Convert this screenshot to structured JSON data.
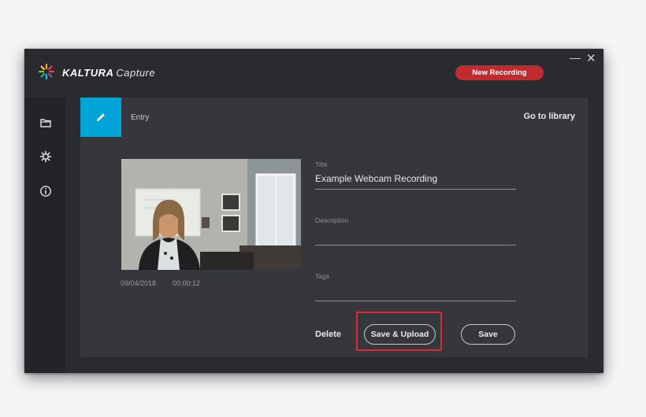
{
  "app": {
    "brand_name": "KALTURA",
    "brand_product": "Capture",
    "new_recording_label": "New Recording",
    "minimize_glyph": "—",
    "close_glyph": "✕"
  },
  "sidebar": {
    "items": [
      {
        "icon": "folder-icon"
      },
      {
        "icon": "gear-icon"
      },
      {
        "icon": "info-icon"
      }
    ]
  },
  "entry": {
    "header_label": "Entry",
    "go_to_library_label": "Go to library",
    "date": "09/04/2018",
    "duration": "00:00:12",
    "title_label": "Title",
    "title_value": "Example Webcam Recording",
    "description_label": "Description",
    "description_value": "",
    "tags_label": "Tags",
    "tags_value": ""
  },
  "actions": {
    "delete_label": "Delete",
    "save_upload_label": "Save & Upload",
    "save_label": "Save"
  },
  "colors": {
    "accent_blue": "#00a3d6",
    "record_red": "#c12a30",
    "highlight_red": "#d12e35"
  }
}
